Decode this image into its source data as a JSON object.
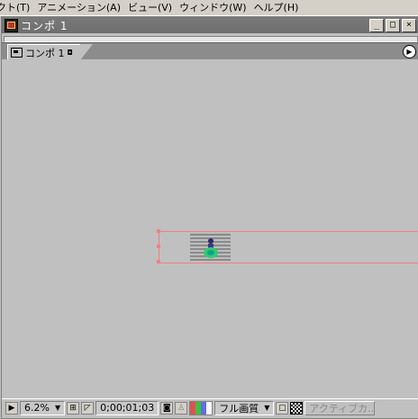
{
  "menu": {
    "items": [
      "クト(T)",
      "アニメーション(A)",
      "ビュー(V)",
      "ウィンドウ(W)",
      "ヘルプ(H)"
    ]
  },
  "window": {
    "title": "コンポ 1",
    "minimize": "_",
    "maximize": "□",
    "close": "×"
  },
  "tab": {
    "label": "コンポ 1",
    "menu_icon": "▶"
  },
  "toolbar": {
    "zoom": "6.2%",
    "timecode": "0;00;01;03",
    "quality": "フル画質",
    "active_camera": "アクティブカ..."
  },
  "colors": {
    "layer_outline": "#f08080",
    "channel_red": "#e05050",
    "channel_green": "#40c040",
    "channel_blue": "#6070e0"
  },
  "icons": {
    "app": "after-effects-comp-icon",
    "composition": "composition-icon",
    "play": "play-icon",
    "grid": "grid-icon",
    "mask": "mask-icon",
    "snapshot": "camera-icon",
    "show_snapshot": "person-icon",
    "roi": "region-of-interest-icon",
    "transparency": "checker-icon"
  }
}
